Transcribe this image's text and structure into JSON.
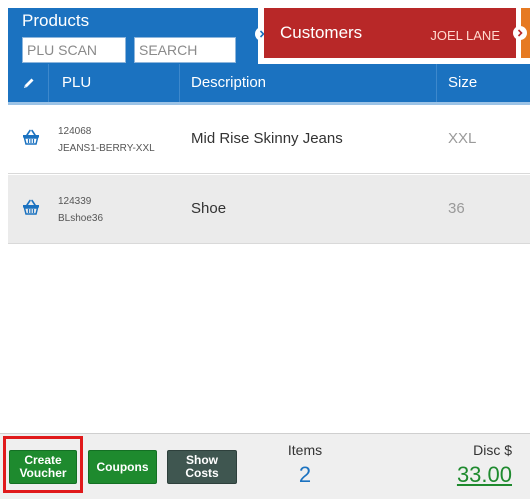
{
  "products_tab": {
    "title": "Products",
    "plu_placeholder": "PLU SCAN",
    "search_placeholder": "SEARCH"
  },
  "customers_tab": {
    "title": "Customers",
    "customer_name": "JOEL LANE"
  },
  "table": {
    "columns": [
      "PLU",
      "Description",
      "Size"
    ],
    "rows": [
      {
        "plu": "124068",
        "sku": "JEANS1-BERRY-XXL",
        "description": "Mid Rise Skinny Jeans",
        "size": "XXL"
      },
      {
        "plu": "124339",
        "sku": "BLshoe36",
        "description": "Shoe",
        "size": "36"
      }
    ]
  },
  "footer": {
    "create_voucher_label": "Create Voucher",
    "coupons_label": "Coupons",
    "show_costs_label": "Show Costs",
    "items_label": "Items",
    "items_value": "2",
    "disc_label": "Disc $",
    "disc_value": "33.00"
  },
  "colors": {
    "primary_blue": "#1b72c0",
    "customers_red": "#b82828",
    "action_green": "#1e8a2e",
    "highlight_red": "#e0191b"
  },
  "icons": {
    "header_edit": "pencil-icon",
    "row_action": "basket-icon",
    "tab_nav": "chevron-right-icon"
  }
}
